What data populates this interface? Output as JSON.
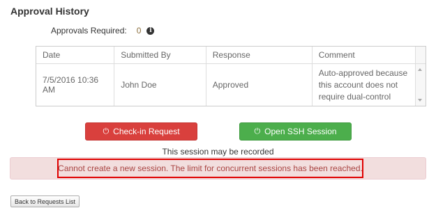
{
  "section": {
    "title": "Approval History",
    "approvals_label": "Approvals Required:",
    "approvals_count": "0",
    "info_icon": "info-circle-icon"
  },
  "table": {
    "headers": [
      "Date",
      "Submitted By",
      "Response",
      "Comment"
    ],
    "rows": [
      {
        "date": "7/5/2016 10:36 AM",
        "submitted_by": "John Doe",
        "response": "Approved",
        "comment": "Auto-approved because this account does not require dual-control"
      }
    ]
  },
  "actions": {
    "checkin_label": "Check-in Request",
    "checkin_icon": "power-icon",
    "ssh_label": "Open SSH Session",
    "ssh_icon": "power-icon"
  },
  "notices": {
    "recorded": "This session may be recorded",
    "error": "Cannot create a new session. The limit for concurrent sessions has been reached."
  },
  "footer": {
    "back_label": "Back to Requests List"
  },
  "colors": {
    "danger": "#d9403d",
    "success": "#4cae4c",
    "alert_bg": "#f2dede",
    "highlight_border": "#e00000"
  }
}
